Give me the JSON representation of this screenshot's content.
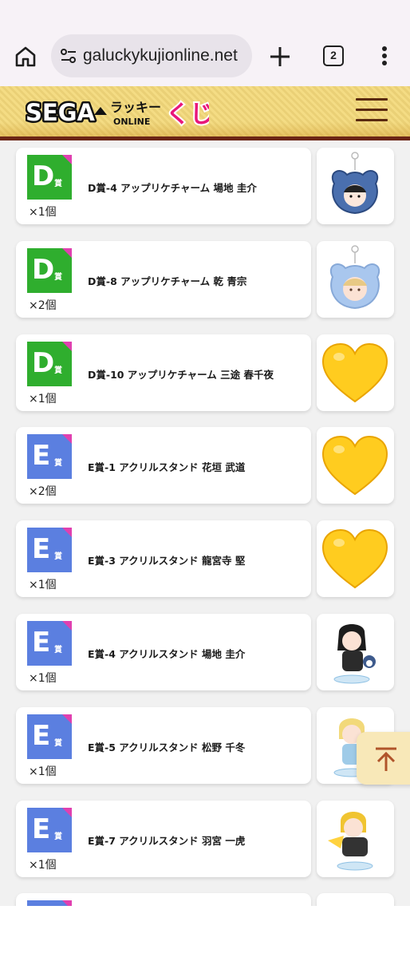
{
  "browser": {
    "url": "galuckykujionline.net",
    "tab_count": "2",
    "icons": {
      "home": "home-icon",
      "site_info": "tune-icon",
      "new_tab": "plus-icon",
      "menu": "more-vert-icon"
    }
  },
  "header": {
    "logo": {
      "part1": "SEGA",
      "part2": "ラッキー",
      "part3": "くじ",
      "part4": "ONLINE"
    },
    "menu_icon": "hamburger-icon"
  },
  "colors": {
    "prize_D": "#2fae2e",
    "prize_E": "#5b7fe0",
    "corner": "#e040b0",
    "header_border": "#6b2515"
  },
  "prizes": [
    {
      "letter": "D",
      "kanji": "賞",
      "name": "D賞-4 アップリケチャーム 場地 圭介",
      "qty": "×1個",
      "thumb": "keychain-bear-dark"
    },
    {
      "letter": "D",
      "kanji": "賞",
      "name": "D賞-8 アップリケチャーム 乾 青宗",
      "qty": "×2個",
      "thumb": "keychain-bear-light"
    },
    {
      "letter": "D",
      "kanji": "賞",
      "name": "D賞-10 アップリケチャーム 三途 春千夜",
      "qty": "×1個",
      "thumb": "heart-emoji"
    },
    {
      "letter": "E",
      "kanji": "賞",
      "name": "E賞-1 アクリルスタンド 花垣 武道",
      "qty": "×2個",
      "thumb": "heart-emoji"
    },
    {
      "letter": "E",
      "kanji": "賞",
      "name": "E賞-3 アクリルスタンド 龍宮寺 堅",
      "qty": "×1個",
      "thumb": "heart-emoji"
    },
    {
      "letter": "E",
      "kanji": "賞",
      "name": "E賞-4 アクリルスタンド 場地 圭介",
      "qty": "×1個",
      "thumb": "acrylic-dark-hair"
    },
    {
      "letter": "E",
      "kanji": "賞",
      "name": "E賞-5 アクリルスタンド 松野 千冬",
      "qty": "×1個",
      "thumb": "acrylic-blond"
    },
    {
      "letter": "E",
      "kanji": "賞",
      "name": "E賞-7 アクリルスタンド 羽宮 一虎",
      "qty": "×1個",
      "thumb": "acrylic-yellow"
    },
    {
      "letter": "E",
      "kanji": "賞",
      "name": "",
      "qty": "",
      "thumb": "partial"
    }
  ],
  "scroll_top_icon": "arrow-up-icon"
}
